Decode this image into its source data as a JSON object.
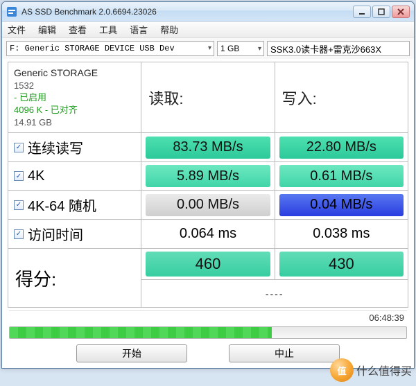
{
  "window": {
    "title": "AS SSD Benchmark 2.0.6694.23026"
  },
  "menu": {
    "file": "文件",
    "edit": "编辑",
    "view": "查看",
    "tools": "工具",
    "lang": "语言",
    "help": "帮助"
  },
  "toolbar": {
    "device": "F: Generic STORAGE DEVICE USB Dev",
    "size": "1 GB",
    "note": "SSK3.0读卡器+雷克沙663X"
  },
  "info": {
    "name": "Generic STORAGE",
    "model": "1532",
    "enabled": "- 已启用",
    "align": "4096 K - 已对齐",
    "capacity": "14.91 GB"
  },
  "headers": {
    "read": "读取:",
    "write": "写入:"
  },
  "rows": {
    "seq": {
      "label": "连续读写",
      "read": "83.73 MB/s",
      "write": "22.80 MB/s"
    },
    "k4": {
      "label": "4K",
      "read": "5.89 MB/s",
      "write": "0.61 MB/s"
    },
    "k464": {
      "label": "4K-64 随机",
      "read": "0.00 MB/s",
      "write": "0.04 MB/s"
    },
    "acc": {
      "label": "访问时间",
      "read": "0.064 ms",
      "write": "0.038 ms"
    }
  },
  "score": {
    "label": "得分:",
    "read": "460",
    "write": "430",
    "total": "----"
  },
  "footer": {
    "elapsed": "06:48:39",
    "start": "开始",
    "stop": "中止"
  },
  "watermark": {
    "orb": "值",
    "text": "什么值得买"
  }
}
